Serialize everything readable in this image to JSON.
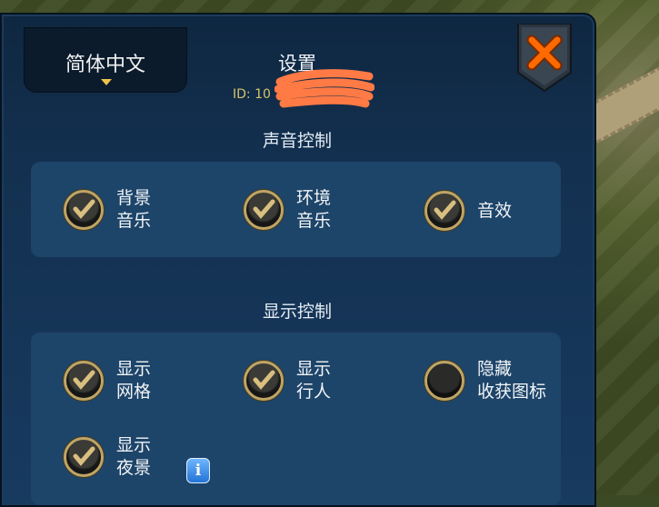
{
  "header": {
    "language_label": "简体中文",
    "title": "设置",
    "id_text": "ID: 10"
  },
  "sections": {
    "sound": {
      "title": "声音控制",
      "options": [
        {
          "label": "背景\n音乐",
          "checked": true
        },
        {
          "label": "环境\n音乐",
          "checked": true
        },
        {
          "label": "音效",
          "checked": true
        }
      ]
    },
    "display": {
      "title": "显示控制",
      "options": [
        {
          "label": "显示\n网格",
          "checked": true
        },
        {
          "label": "显示\n行人",
          "checked": true
        },
        {
          "label": "隐藏\n收获图标",
          "checked": false
        },
        {
          "label": "显示\n夜景",
          "checked": true
        }
      ]
    }
  },
  "icons": {
    "close": "close-x-icon",
    "info": "info-icon",
    "info_glyph": "i",
    "dropdown": "caret-down-icon"
  },
  "colors": {
    "panel": "#173a5f",
    "box": "#1d4469",
    "accent_gold": "#bfa565",
    "close_orange": "#ff6a00"
  }
}
